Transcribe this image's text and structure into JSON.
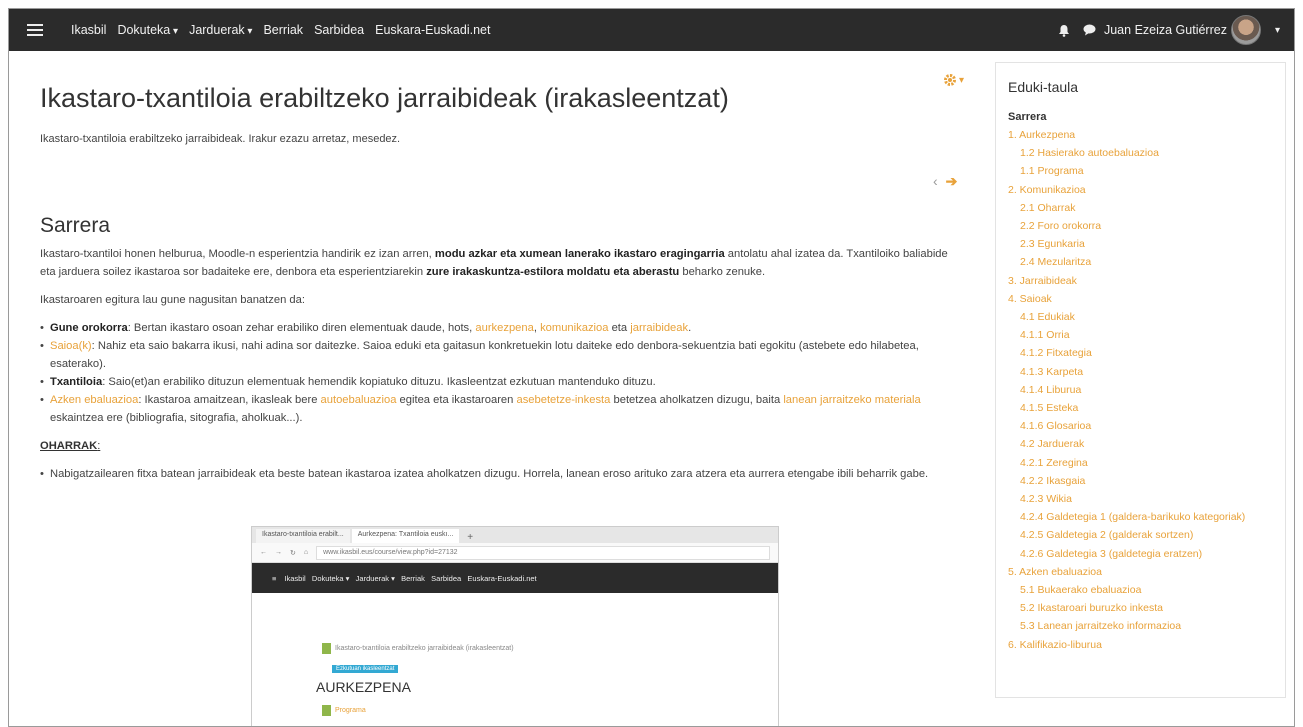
{
  "topbar": {
    "nav": [
      {
        "label": "Ikasbil",
        "dropdown": false
      },
      {
        "label": "Dokuteka",
        "dropdown": true
      },
      {
        "label": "Jarduerak",
        "dropdown": true
      },
      {
        "label": "Berriak",
        "dropdown": false
      },
      {
        "label": "Sarbidea",
        "dropdown": false
      },
      {
        "label": "Euskara-Euskadi.net",
        "dropdown": false
      }
    ],
    "user_name": "Juan Ezeiza Gutiérrez"
  },
  "page": {
    "title": "Ikastaro-txantiloia erabiltzeko jarraibideak (irakasleentzat)",
    "intro": "Ikastaro-txantiloia erabiltzeko jarraibideak. Irakur ezazu arretaz, mesedez.",
    "section_title": "Sarrera",
    "p1_a": "Ikastaro-txantiloi honen helburua, Moodle-n esperientzia handirik ez izan arren, ",
    "p1_b": "modu azkar eta xumean lanerako ikastaro eragingarria",
    "p1_c": " antolatu ahal izatea da. Txantiloiko baliabide eta jarduera soilez ikastaroa sor badaiteke ere, denbora eta esperientziarekin ",
    "p1_d": "zure irakaskuntza-estilora moldatu eta aberastu",
    "p1_e": " beharko zenuke.",
    "p2": "Ikastaroaren egitura lau gune nagusitan banatzen da:",
    "b1_a": "Gune orokorra",
    "b1_b": ": Bertan ikastaro osoan zehar erabiliko diren elementuak daude, hots, ",
    "b1_l1": "aurkezpena",
    "b1_c": ", ",
    "b1_l2": "komunikazioa",
    "b1_d": " eta ",
    "b1_l3": "jarraibideak",
    "b1_e": ".",
    "b2_l": "Saioa(k)",
    "b2_b": ": Nahiz eta saio bakarra ikusi, nahi adina sor daitezke. Saioa eduki eta gaitasun konkretuekin lotu daiteke edo denbora-sekuentzia bati egokitu (astebete edo hilabetea, esaterako).",
    "b3_a": "Txantiloia",
    "b3_b": ": Saio(et)an erabiliko dituzun elementuak hemendik kopiatuko dituzu. Ikasleentzat ezkutuan mantenduko dituzu.",
    "b4_l": "Azken ebaluazioa",
    "b4_b": ": Ikastaroa amaitzean, ikasleak bere ",
    "b4_l2": "autoebaluazioa",
    "b4_c": " egitea eta ikastaroaren ",
    "b4_l3": "asebetetze-inkesta",
    "b4_d": " betetzea aholkatzen dizugu, baita ",
    "b4_l4": "lanean jarraitzeko materiala",
    "b4_e": " eskaintzea ere (bibliografia, sitografia, aholkuak...).",
    "notes_title": "OHARRAK",
    "notes_colon": ":",
    "note1": "Nabigatzailearen fitxa batean jarraibideak eta beste batean ikastaroa izatea aholkatzen dizugu. Horrela, lanean eroso arituko zara atzera eta aurrera etengabe ibili beharrik gabe."
  },
  "screenshot": {
    "tab1": "Ikastaro-txantiloia erabilt...",
    "tab2": "Aurkezpena: Txantiloia euskı...",
    "url": "www.ikasbil.eus/course/view.php?id=27132",
    "nav": "Ikasbil   Dokuteka ▾   Jarduerak ▾   Berriak   Sarbidea   Euskara-Euskadi.net",
    "page_link": "Ikastaro-txantiloia erabiltzeko jarraibideak (irakasleentzat)",
    "badge": "Ezkutuan ikasleentzat",
    "heading": "AURKEZPENA",
    "program": "Programa"
  },
  "toc": {
    "title": "Eduki-taula",
    "head": "Sarrera",
    "items": [
      {
        "label": "1. Aurkezpena",
        "level": 1
      },
      {
        "label": "1.2 Hasierako autoebaluazioa",
        "level": 2
      },
      {
        "label": "1.1 Programa",
        "level": 2
      },
      {
        "label": "2. Komunikazioa",
        "level": 1
      },
      {
        "label": "2.1 Oharrak",
        "level": 2
      },
      {
        "label": "2.2 Foro orokorra",
        "level": 2
      },
      {
        "label": "2.3 Egunkaria",
        "level": 2
      },
      {
        "label": "2.4 Mezularitza",
        "level": 2
      },
      {
        "label": "3. Jarraibideak",
        "level": 1
      },
      {
        "label": "4. Saioak",
        "level": 1
      },
      {
        "label": "4.1 Edukiak",
        "level": 2
      },
      {
        "label": "4.1.1 Orria",
        "level": 2
      },
      {
        "label": "4.1.2 Fitxategia",
        "level": 2
      },
      {
        "label": "4.1.3 Karpeta",
        "level": 2
      },
      {
        "label": "4.1.4 Liburua",
        "level": 2
      },
      {
        "label": "4.1.5 Esteka",
        "level": 2
      },
      {
        "label": "4.1.6 Glosarioa",
        "level": 2
      },
      {
        "label": "4.2 Jarduerak",
        "level": 2
      },
      {
        "label": "4.2.1 Zereginа",
        "level": 2
      },
      {
        "label": "4.2.2 Ikasgaia",
        "level": 2
      },
      {
        "label": "4.2.3 Wikia",
        "level": 2
      },
      {
        "label": "4.2.4 Galdetegia 1 (galdera-barikuko kategoriak)",
        "level": 2
      },
      {
        "label": "4.2.5 Galdetegia 2 (galderak sortzen)",
        "level": 2
      },
      {
        "label": "4.2.6 Galdetegia 3 (galdetegia eratzen)",
        "level": 2
      },
      {
        "label": "5. Azken ebaluazioa",
        "level": 1
      },
      {
        "label": "5.1 Bukaerako ebaluazioa",
        "level": 2
      },
      {
        "label": "5.2 Ikastaroari buruzko inkesta",
        "level": 2
      },
      {
        "label": "5.3 Lanean jarraitzeko informazioa",
        "level": 2
      },
      {
        "label": "6. Kalifikazio-liburua",
        "level": 1
      }
    ]
  },
  "colors": {
    "accent": "#e8a23a",
    "topbar": "#2b2b2b"
  }
}
